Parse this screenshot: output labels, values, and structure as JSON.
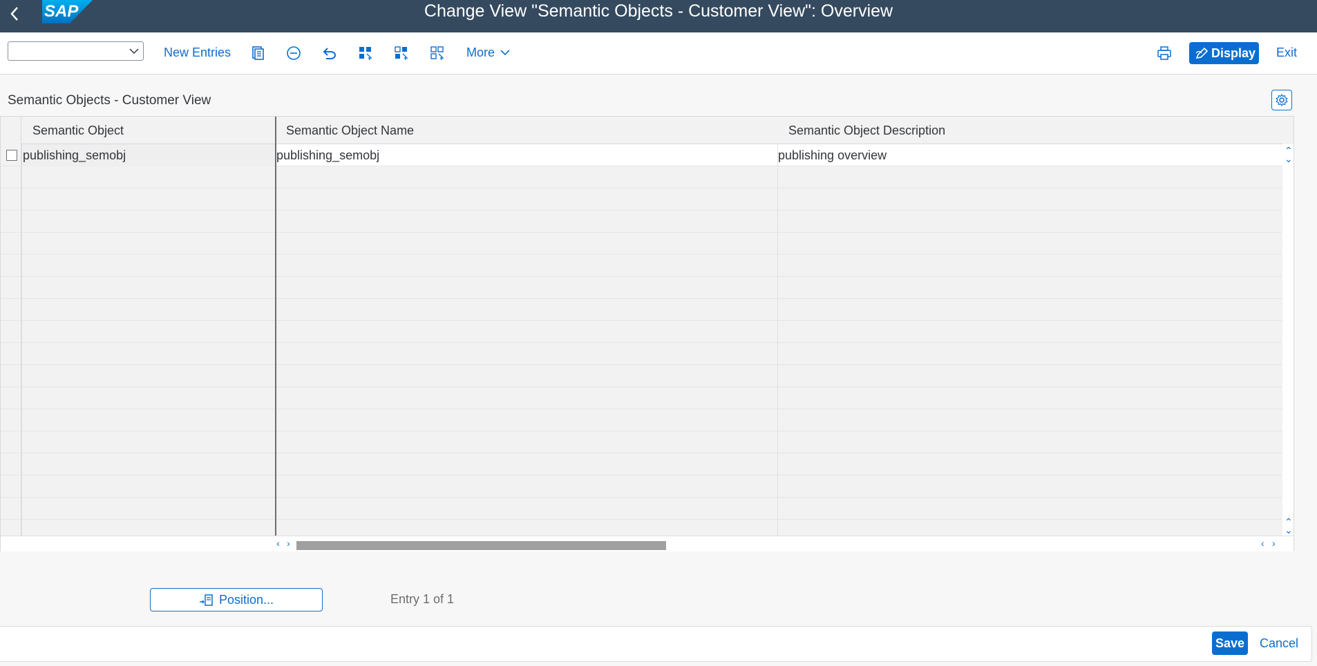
{
  "shell": {
    "title": "Change View \"Semantic Objects - Customer View\": Overview",
    "logo_text": "SAP",
    "back_icon": "chevron-left-icon"
  },
  "toolbar": {
    "combo_value": "",
    "new_entries": "New Entries",
    "more": "More",
    "display": "Display",
    "exit": "Exit",
    "icons": [
      "copy-icon",
      "delete-icon",
      "undo-icon",
      "select-all-icon",
      "select-block-icon",
      "deselect-all-icon",
      "print-icon",
      "display-change-icon"
    ]
  },
  "section": {
    "title": "Semantic Objects - Customer View"
  },
  "table": {
    "columns": [
      "Semantic Object",
      "Semantic Object Name",
      "Semantic Object Description"
    ],
    "rows": [
      [
        "publishing_semobj",
        "publishing_semobj",
        "publishing overview"
      ]
    ]
  },
  "bottom": {
    "position_button": "Position...",
    "entry_text": "Entry 1 of 1"
  },
  "footer": {
    "save": "Save",
    "cancel": "Cancel"
  },
  "colors": {
    "shell": "#354a5f",
    "accent": "#0a6ed1",
    "background": "#f7f7f7"
  }
}
